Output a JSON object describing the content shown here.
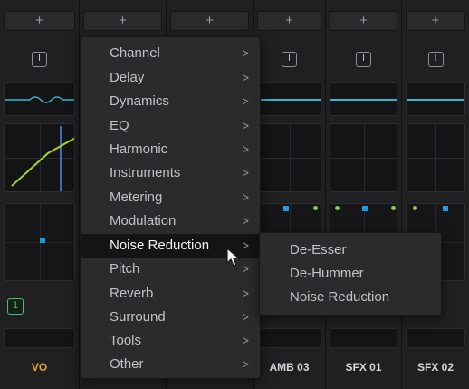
{
  "mixer": {
    "plus_label": "+",
    "insert_label": "I",
    "strips": [
      {
        "name": "VO",
        "name_color": "#e6a623",
        "vca_badge": "1"
      },
      {
        "name": ""
      },
      {
        "name": ""
      },
      {
        "name": "AMB 03"
      },
      {
        "name": "SFX 01"
      },
      {
        "name": "SFX 02"
      }
    ]
  },
  "context_menu": {
    "chevron": ">",
    "items": [
      {
        "label": "Channel"
      },
      {
        "label": "Delay"
      },
      {
        "label": "Dynamics"
      },
      {
        "label": "EQ"
      },
      {
        "label": "Harmonic"
      },
      {
        "label": "Instruments"
      },
      {
        "label": "Metering"
      },
      {
        "label": "Modulation"
      },
      {
        "label": "Noise Reduction",
        "active": true
      },
      {
        "label": "Pitch"
      },
      {
        "label": "Reverb"
      },
      {
        "label": "Surround"
      },
      {
        "label": "Tools"
      },
      {
        "label": "Other"
      }
    ]
  },
  "submenu": {
    "items": [
      {
        "label": "De-Esser"
      },
      {
        "label": "De-Hummer"
      },
      {
        "label": "Noise Reduction"
      }
    ]
  },
  "colors": {
    "accent_cyan": "#33b8c9",
    "accent_blue": "#1e9be0",
    "accent_green": "#7fd14a",
    "vo_label": "#e6a623",
    "vca_badge": "#3ec26a"
  },
  "icons": {
    "cursor": "arrow-pointer-icon"
  }
}
